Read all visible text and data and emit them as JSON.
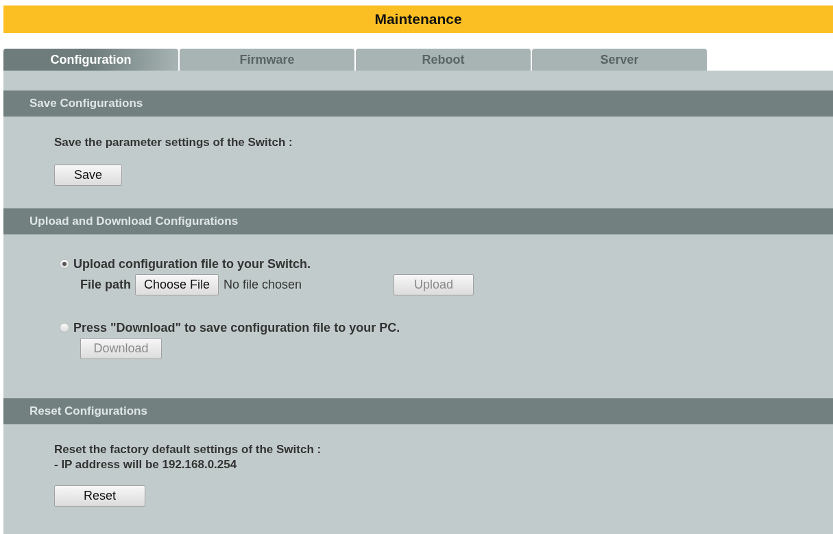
{
  "title": "Maintenance",
  "tabs": [
    {
      "label": "Configuration",
      "selected": true
    },
    {
      "label": "Firmware",
      "selected": false
    },
    {
      "label": "Reboot",
      "selected": false
    },
    {
      "label": "Server",
      "selected": false
    }
  ],
  "save_section": {
    "heading": "Save Configurations",
    "description": "Save the parameter settings of the Switch :",
    "button": "Save"
  },
  "transfer_section": {
    "heading": "Upload and Download Configurations",
    "upload": {
      "label": "Upload configuration file to your Switch.",
      "selected": true,
      "file_label": "File path",
      "choose_button": "Choose File",
      "file_status": "No file chosen",
      "button": "Upload",
      "disabled": true
    },
    "download": {
      "label": "Press \"Download\" to save configuration file to your PC.",
      "selected": false,
      "button": "Download",
      "disabled": true
    }
  },
  "reset_section": {
    "heading": "Reset Configurations",
    "lines": [
      "Reset the factory default settings of the Switch :",
      "- IP address will be 192.168.0.254"
    ],
    "button": "Reset"
  }
}
